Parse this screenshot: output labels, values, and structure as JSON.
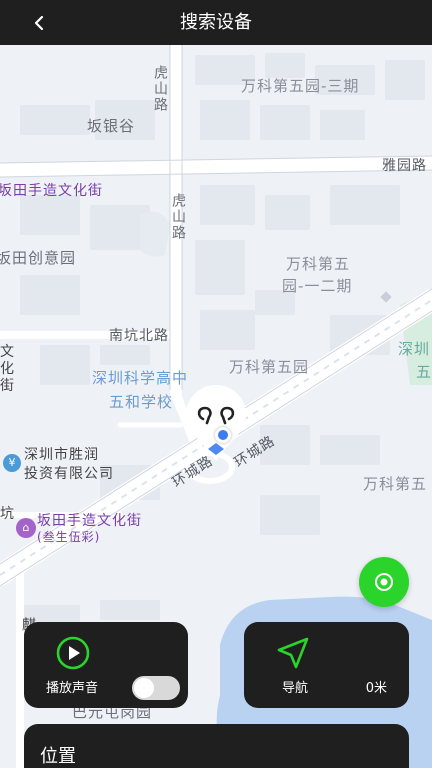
{
  "header": {
    "title": "搜索设备"
  },
  "map": {
    "labels": {
      "vanke_5_phase3": "万科第五园-三期",
      "huguan_road": "虎山路",
      "bantian_yin": "坂银谷",
      "yayuan_road": "雅园路",
      "bantian_craft_top": "坂田手造文化街",
      "huguan_road_2": "虎山路",
      "bantian_creative": "坂田创意园",
      "vanke_5_phase12_a": "万科第五",
      "vanke_5_phase12_b": "园-一二期",
      "nankeng_north_road": "南坑北路",
      "shenzhen_kexue_a": "深圳科学高中",
      "shenzhen_kexue_b": "五和学校",
      "vanke_5_park": "万科第五园",
      "shenzhen_partial": "深圳",
      "wu_partial": "五",
      "wen": "文",
      "hua": "化",
      "jie": "街",
      "shengrun_a": "深圳市胜润",
      "shengrun_b": "投资有限公司",
      "huancheng_road_1": "环城路",
      "huancheng_road_2": "环城路",
      "vanke_5_right": "万科第五",
      "hang": "坑",
      "bantian_craft_bottom_a": "坂田手造文化街",
      "bantian_craft_bottom_b": "(叁生伍彩)",
      "bottom_partial": "巴元屯岗园",
      "lu_partial": "麒"
    }
  },
  "sound_card": {
    "label": "播放声音",
    "toggle_on": false
  },
  "nav_card": {
    "label": "导航",
    "distance": "0米"
  },
  "location_panel": {
    "title": "位置"
  },
  "colors": {
    "accent_green": "#2bd42b",
    "card_bg": "#1f1f1f",
    "header_bg": "#1f1f1f",
    "location_blue": "#3b7cf0"
  }
}
